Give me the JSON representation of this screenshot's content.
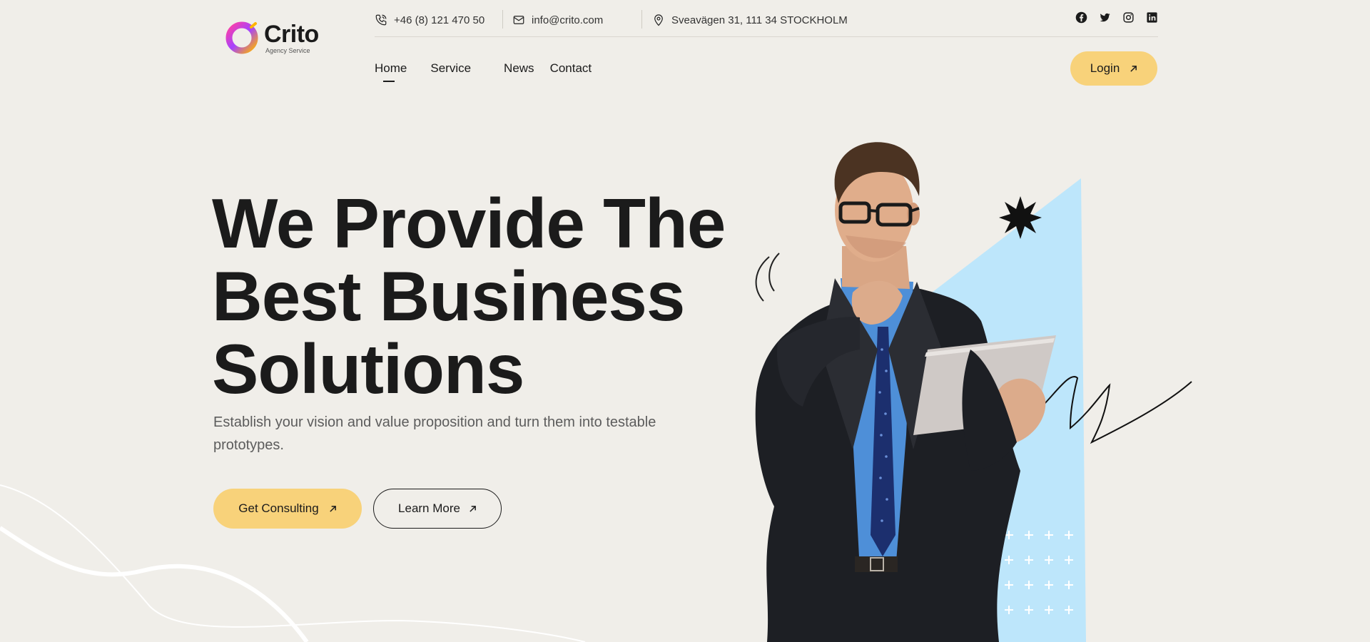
{
  "brand": {
    "name": "Crito",
    "tagline": "Agency Service",
    "colors": {
      "accent_yellow": "#f8d27a",
      "sky_blue": "#bde6fb",
      "background": "#f0eee9",
      "text": "#1b1b1b"
    }
  },
  "topbar": {
    "phone": "+46 (8) 121 470 50",
    "email": "info@crito.com",
    "address": "Sveavägen 31, 111 34 STOCKHOLM",
    "icons": {
      "phone": "phone-icon",
      "email": "mail-icon",
      "address": "map-pin-icon"
    },
    "socials": [
      "facebook-icon",
      "twitter-icon",
      "instagram-icon",
      "linkedin-icon"
    ]
  },
  "nav": {
    "items": [
      {
        "label": "Home",
        "active": true
      },
      {
        "label": "Service",
        "active": false
      },
      {
        "label": "News",
        "active": false
      },
      {
        "label": "Contact",
        "active": false
      }
    ],
    "login_label": "Login"
  },
  "hero": {
    "title_line1": "We Provide The",
    "title_line2": "Best Business",
    "title_line3": "Solutions",
    "subtitle": "Establish your vision and value proposition and turn them into testable prototypes.",
    "primary_cta": "Get Consulting",
    "secondary_cta": "Learn More"
  }
}
